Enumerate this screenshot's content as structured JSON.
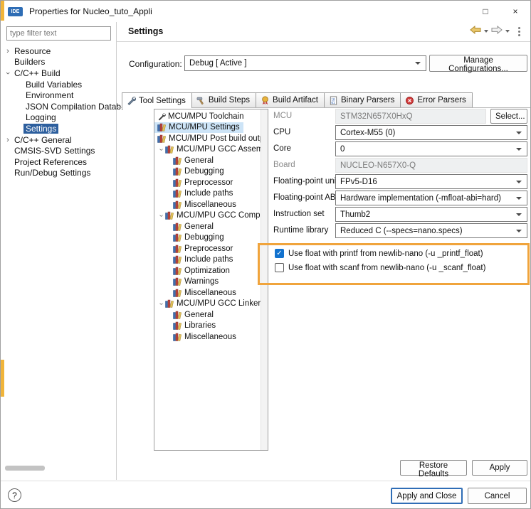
{
  "window": {
    "title": "Properties for Nucleo_tuto_Appli",
    "app_icon_label": "IDE",
    "controls": {
      "maximize": "□",
      "close": "×"
    }
  },
  "sidebar": {
    "filter_placeholder": "type filter text",
    "items": [
      {
        "label": "Resource",
        "level": 0,
        "state": "collapsed",
        "selected": false
      },
      {
        "label": "Builders",
        "level": 0,
        "state": "none",
        "selected": false
      },
      {
        "label": "C/C++ Build",
        "level": 0,
        "state": "expanded",
        "selected": false
      },
      {
        "label": "Build Variables",
        "level": 1,
        "state": "none",
        "selected": false
      },
      {
        "label": "Environment",
        "level": 1,
        "state": "none",
        "selected": false
      },
      {
        "label": "JSON Compilation Datab:",
        "level": 1,
        "state": "none",
        "selected": false
      },
      {
        "label": "Logging",
        "level": 1,
        "state": "none",
        "selected": false
      },
      {
        "label": "Settings",
        "level": 1,
        "state": "none",
        "selected": true
      },
      {
        "label": "C/C++ General",
        "level": 0,
        "state": "collapsed",
        "selected": false
      },
      {
        "label": "CMSIS-SVD Settings",
        "level": 0,
        "state": "none",
        "selected": false
      },
      {
        "label": "Project References",
        "level": 0,
        "state": "none",
        "selected": false
      },
      {
        "label": "Run/Debug Settings",
        "level": 0,
        "state": "none",
        "selected": false
      }
    ]
  },
  "content": {
    "title": "Settings",
    "configuration": {
      "label": "Configuration:",
      "value": "Debug [ Active ]",
      "manage_button": "Manage Configurations..."
    },
    "tabs": [
      {
        "label": "Tool Settings",
        "selected": true
      },
      {
        "label": "Build Steps",
        "selected": false
      },
      {
        "label": "Build Artifact",
        "selected": false
      },
      {
        "label": "Binary Parsers",
        "selected": false
      },
      {
        "label": "Error Parsers",
        "selected": false
      }
    ],
    "tool_tree": {
      "items": [
        {
          "label": "MCU/MPU Toolchain",
          "icon": "wrench",
          "level": 0,
          "state": "none",
          "selected": false
        },
        {
          "label": "MCU/MPU Settings",
          "icon": "books",
          "level": 0,
          "state": "none",
          "selected": true
        },
        {
          "label": "MCU/MPU Post build outputs",
          "icon": "books",
          "level": 0,
          "state": "none",
          "selected": false
        },
        {
          "label": "MCU/MPU GCC Assembler",
          "icon": "books",
          "level": 0,
          "state": "expanded",
          "selected": false
        },
        {
          "label": "General",
          "icon": "books",
          "level": 1,
          "state": "none",
          "selected": false
        },
        {
          "label": "Debugging",
          "icon": "books",
          "level": 1,
          "state": "none",
          "selected": false
        },
        {
          "label": "Preprocessor",
          "icon": "books",
          "level": 1,
          "state": "none",
          "selected": false
        },
        {
          "label": "Include paths",
          "icon": "books",
          "level": 1,
          "state": "none",
          "selected": false
        },
        {
          "label": "Miscellaneous",
          "icon": "books",
          "level": 1,
          "state": "none",
          "selected": false
        },
        {
          "label": "MCU/MPU GCC Compiler",
          "icon": "books",
          "level": 0,
          "state": "expanded",
          "selected": false
        },
        {
          "label": "General",
          "icon": "books",
          "level": 1,
          "state": "none",
          "selected": false
        },
        {
          "label": "Debugging",
          "icon": "books",
          "level": 1,
          "state": "none",
          "selected": false
        },
        {
          "label": "Preprocessor",
          "icon": "books",
          "level": 1,
          "state": "none",
          "selected": false
        },
        {
          "label": "Include paths",
          "icon": "books",
          "level": 1,
          "state": "none",
          "selected": false
        },
        {
          "label": "Optimization",
          "icon": "books",
          "level": 1,
          "state": "none",
          "selected": false
        },
        {
          "label": "Warnings",
          "icon": "books",
          "level": 1,
          "state": "none",
          "selected": false
        },
        {
          "label": "Miscellaneous",
          "icon": "books",
          "level": 1,
          "state": "none",
          "selected": false
        },
        {
          "label": "MCU/MPU GCC Linker",
          "icon": "books",
          "level": 0,
          "state": "expanded",
          "selected": false
        },
        {
          "label": "General",
          "icon": "books",
          "level": 1,
          "state": "none",
          "selected": false
        },
        {
          "label": "Libraries",
          "icon": "books",
          "level": 1,
          "state": "none",
          "selected": false
        },
        {
          "label": "Miscellaneous",
          "icon": "books",
          "level": 1,
          "state": "none",
          "selected": false
        }
      ]
    },
    "form": {
      "fields": [
        {
          "label": "MCU",
          "value": "STM32N657X0HxQ",
          "type": "readonly",
          "button": "Select..."
        },
        {
          "label": "CPU",
          "value": "Cortex-M55 (0)",
          "type": "combo"
        },
        {
          "label": "Core",
          "value": "0",
          "type": "combo"
        },
        {
          "label": "Board",
          "value": "NUCLEO-N657X0-Q",
          "type": "readonly"
        },
        {
          "label": "Floating-point unit",
          "value": "FPv5-D16",
          "type": "combo"
        },
        {
          "label": "Floating-point ABI",
          "value": "Hardware implementation (-mfloat-abi=hard)",
          "type": "combo"
        },
        {
          "label": "Instruction set",
          "value": "Thumb2",
          "type": "combo"
        },
        {
          "label": "Runtime library",
          "value": "Reduced C (--specs=nano.specs)",
          "type": "combo"
        }
      ],
      "checkboxes": [
        {
          "label": "Use float with printf from newlib-nano (-u _printf_float)",
          "checked": true,
          "check_glyph": "✓"
        },
        {
          "label": "Use float with scanf from newlib-nano (-u _scanf_float)",
          "checked": false,
          "check_glyph": ""
        }
      ]
    },
    "buttons": {
      "restore_defaults": "Restore Defaults",
      "apply": "Apply"
    }
  },
  "footer": {
    "help": "?",
    "apply_and_close": "Apply and Close",
    "cancel": "Cancel"
  },
  "annotation": {
    "highlight_color": "#f0a43c",
    "edge_color": "#f0b43a"
  }
}
